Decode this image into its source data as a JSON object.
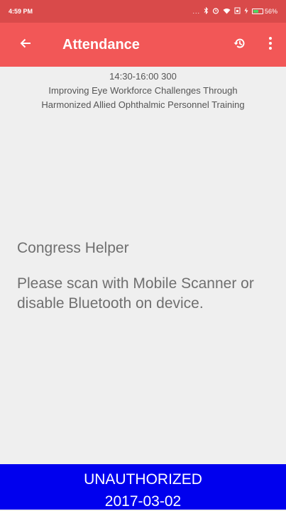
{
  "status_bar": {
    "time": "4:59 PM",
    "signal_dots": "...",
    "battery_text": "56%",
    "battery_level": 0.56,
    "icons": [
      "bluetooth-icon",
      "alarm-icon",
      "wifi-icon",
      "sim-icon",
      "charging-icon",
      "battery-icon"
    ]
  },
  "toolbar": {
    "title": "Attendance",
    "back_icon": "arrow-left-icon",
    "history_icon": "history-icon",
    "more_icon": "more-vertical-icon"
  },
  "session": {
    "time_room": "14:30-16:00 300",
    "title_line1": "Improving Eye Workforce Challenges Through",
    "title_line2": "Harmonized Allied Ophthalmic Personnel Training"
  },
  "message": {
    "helper": "Congress Helper",
    "instruction": "Please scan with Mobile Scanner or disable Bluetooth on device."
  },
  "footer": {
    "status": "UNAUTHORIZED",
    "date": "2017-03-02"
  },
  "colors": {
    "status_bar": "#d94a4a",
    "toolbar": "#f25757",
    "background": "#efefef",
    "footer": "#0000ee"
  }
}
